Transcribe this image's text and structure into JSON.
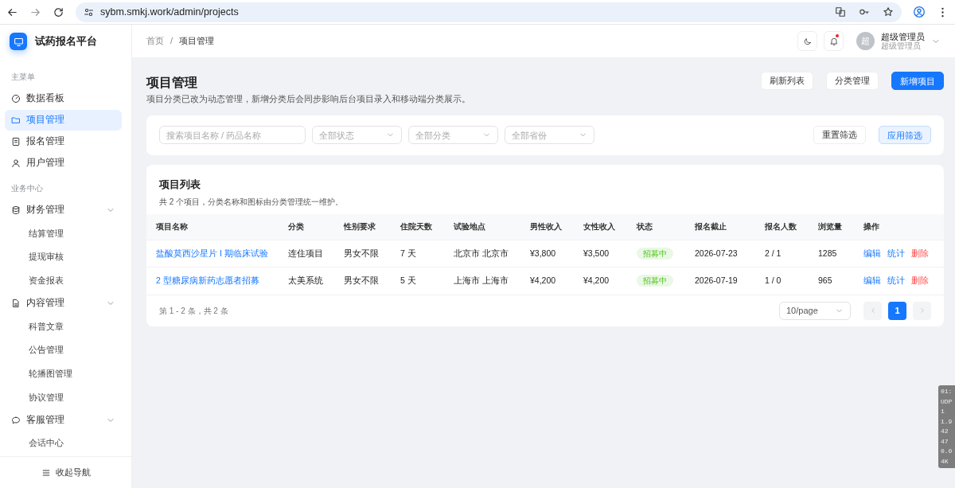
{
  "browser": {
    "url": "sybm.smkj.work/admin/projects"
  },
  "brand": {
    "title": "试药报名平台"
  },
  "sidebar": {
    "groups": [
      {
        "title": "主菜单",
        "items": [
          {
            "label": "数据看板",
            "selected": false
          },
          {
            "label": "项目管理",
            "selected": true
          },
          {
            "label": "报名管理",
            "selected": false
          },
          {
            "label": "用户管理",
            "selected": false
          }
        ]
      },
      {
        "title": "业务中心",
        "items": [
          {
            "label": "财务管理",
            "selected": false,
            "expanded": true,
            "children": [
              {
                "label": "结算管理",
                "selected": false
              },
              {
                "label": "提现审核",
                "selected": false
              },
              {
                "label": "资金报表",
                "selected": false
              }
            ]
          },
          {
            "label": "内容管理",
            "selected": false,
            "expanded": true,
            "children": [
              {
                "label": "科普文章",
                "selected": false
              },
              {
                "label": "公告管理",
                "selected": false
              },
              {
                "label": "轮播图管理",
                "selected": false
              },
              {
                "label": "协议管理",
                "selected": false
              }
            ]
          },
          {
            "label": "客服管理",
            "selected": false,
            "expanded": true,
            "children": [
              {
                "label": "会话中心",
                "selected": false
              }
            ]
          }
        ]
      }
    ],
    "collapse": "收起导航"
  },
  "header": {
    "breadcrumb": [
      "首页",
      "项目管理"
    ],
    "breadcrumb_separator": "/",
    "notifications_unread": true,
    "user": {
      "avatar": "超",
      "name": "超级管理员",
      "role": "超级管理员"
    }
  },
  "page": {
    "title": "项目管理",
    "subtitle": "项目分类已改为动态管理，新增分类后会同步影响后台项目录入和移动端分类展示。",
    "actions": [
      {
        "label": "刷新列表",
        "primary": false
      },
      {
        "label": "分类管理",
        "primary": false
      },
      {
        "label": "新增项目",
        "primary": true
      }
    ]
  },
  "filters": {
    "search": {
      "placeholder": "搜索项目名称 / 药品名称"
    },
    "selects": [
      {
        "placeholder": "全部状态"
      },
      {
        "placeholder": "全部分类"
      },
      {
        "placeholder": "全部省份"
      }
    ],
    "buttons": [
      {
        "label": "重置筛选",
        "primary": false
      },
      {
        "label": "应用筛选",
        "primary": true
      }
    ]
  },
  "table": {
    "title": "项目列表",
    "subtitle": "共 2 个项目，分类名称和图标由分类管理统一维护。",
    "columns": [
      "项目名称",
      "分类",
      "性别要求",
      "住院天数",
      "试验地点",
      "男性收入",
      "女性收入",
      "状态",
      "报名截止",
      "报名人数",
      "浏览量",
      "操作"
    ],
    "rows": [
      {
        "name": "盐酸莫西沙星片 I 期临床试验",
        "category": "连住项目",
        "gender": "男女不限",
        "days": "7 天",
        "location": "北京市 北京市",
        "male_income": "¥3,800",
        "female_income": "¥3,500",
        "status": "招募中",
        "deadline": "2026-07-23",
        "signups": "2 / 1",
        "views": "1285",
        "actions": [
          "编辑",
          "统计",
          "删除"
        ]
      },
      {
        "name": "2 型糖尿病新药志愿者招募",
        "category": "太美系统",
        "gender": "男女不限",
        "days": "5 天",
        "location": "上海市 上海市",
        "male_income": "¥4,200",
        "female_income": "¥4,200",
        "status": "招募中",
        "deadline": "2026-07-19",
        "signups": "1 / 0",
        "views": "965",
        "actions": [
          "编辑",
          "统计",
          "删除"
        ]
      }
    ],
    "summary": "第 1 - 2 条，共 2 条",
    "page_size": "10/page",
    "pages": [
      {
        "label": "1",
        "selected": true
      }
    ]
  },
  "overlay": {
    "lines": [
      "01:",
      "UDP",
      "1",
      "1.9",
      "42",
      "47",
      "0.0",
      "4K"
    ]
  }
}
